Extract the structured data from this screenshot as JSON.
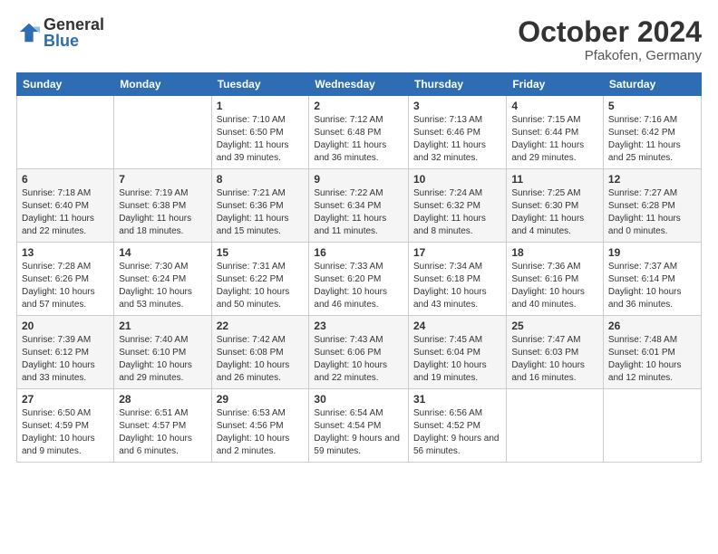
{
  "logo": {
    "general": "General",
    "blue": "Blue"
  },
  "header": {
    "month": "October 2024",
    "location": "Pfakofen, Germany"
  },
  "weekdays": [
    "Sunday",
    "Monday",
    "Tuesday",
    "Wednesday",
    "Thursday",
    "Friday",
    "Saturday"
  ],
  "weeks": [
    [
      {
        "day": "",
        "detail": ""
      },
      {
        "day": "",
        "detail": ""
      },
      {
        "day": "1",
        "detail": "Sunrise: 7:10 AM\nSunset: 6:50 PM\nDaylight: 11 hours and 39 minutes."
      },
      {
        "day": "2",
        "detail": "Sunrise: 7:12 AM\nSunset: 6:48 PM\nDaylight: 11 hours and 36 minutes."
      },
      {
        "day": "3",
        "detail": "Sunrise: 7:13 AM\nSunset: 6:46 PM\nDaylight: 11 hours and 32 minutes."
      },
      {
        "day": "4",
        "detail": "Sunrise: 7:15 AM\nSunset: 6:44 PM\nDaylight: 11 hours and 29 minutes."
      },
      {
        "day": "5",
        "detail": "Sunrise: 7:16 AM\nSunset: 6:42 PM\nDaylight: 11 hours and 25 minutes."
      }
    ],
    [
      {
        "day": "6",
        "detail": "Sunrise: 7:18 AM\nSunset: 6:40 PM\nDaylight: 11 hours and 22 minutes."
      },
      {
        "day": "7",
        "detail": "Sunrise: 7:19 AM\nSunset: 6:38 PM\nDaylight: 11 hours and 18 minutes."
      },
      {
        "day": "8",
        "detail": "Sunrise: 7:21 AM\nSunset: 6:36 PM\nDaylight: 11 hours and 15 minutes."
      },
      {
        "day": "9",
        "detail": "Sunrise: 7:22 AM\nSunset: 6:34 PM\nDaylight: 11 hours and 11 minutes."
      },
      {
        "day": "10",
        "detail": "Sunrise: 7:24 AM\nSunset: 6:32 PM\nDaylight: 11 hours and 8 minutes."
      },
      {
        "day": "11",
        "detail": "Sunrise: 7:25 AM\nSunset: 6:30 PM\nDaylight: 11 hours and 4 minutes."
      },
      {
        "day": "12",
        "detail": "Sunrise: 7:27 AM\nSunset: 6:28 PM\nDaylight: 11 hours and 0 minutes."
      }
    ],
    [
      {
        "day": "13",
        "detail": "Sunrise: 7:28 AM\nSunset: 6:26 PM\nDaylight: 10 hours and 57 minutes."
      },
      {
        "day": "14",
        "detail": "Sunrise: 7:30 AM\nSunset: 6:24 PM\nDaylight: 10 hours and 53 minutes."
      },
      {
        "day": "15",
        "detail": "Sunrise: 7:31 AM\nSunset: 6:22 PM\nDaylight: 10 hours and 50 minutes."
      },
      {
        "day": "16",
        "detail": "Sunrise: 7:33 AM\nSunset: 6:20 PM\nDaylight: 10 hours and 46 minutes."
      },
      {
        "day": "17",
        "detail": "Sunrise: 7:34 AM\nSunset: 6:18 PM\nDaylight: 10 hours and 43 minutes."
      },
      {
        "day": "18",
        "detail": "Sunrise: 7:36 AM\nSunset: 6:16 PM\nDaylight: 10 hours and 40 minutes."
      },
      {
        "day": "19",
        "detail": "Sunrise: 7:37 AM\nSunset: 6:14 PM\nDaylight: 10 hours and 36 minutes."
      }
    ],
    [
      {
        "day": "20",
        "detail": "Sunrise: 7:39 AM\nSunset: 6:12 PM\nDaylight: 10 hours and 33 minutes."
      },
      {
        "day": "21",
        "detail": "Sunrise: 7:40 AM\nSunset: 6:10 PM\nDaylight: 10 hours and 29 minutes."
      },
      {
        "day": "22",
        "detail": "Sunrise: 7:42 AM\nSunset: 6:08 PM\nDaylight: 10 hours and 26 minutes."
      },
      {
        "day": "23",
        "detail": "Sunrise: 7:43 AM\nSunset: 6:06 PM\nDaylight: 10 hours and 22 minutes."
      },
      {
        "day": "24",
        "detail": "Sunrise: 7:45 AM\nSunset: 6:04 PM\nDaylight: 10 hours and 19 minutes."
      },
      {
        "day": "25",
        "detail": "Sunrise: 7:47 AM\nSunset: 6:03 PM\nDaylight: 10 hours and 16 minutes."
      },
      {
        "day": "26",
        "detail": "Sunrise: 7:48 AM\nSunset: 6:01 PM\nDaylight: 10 hours and 12 minutes."
      }
    ],
    [
      {
        "day": "27",
        "detail": "Sunrise: 6:50 AM\nSunset: 4:59 PM\nDaylight: 10 hours and 9 minutes."
      },
      {
        "day": "28",
        "detail": "Sunrise: 6:51 AM\nSunset: 4:57 PM\nDaylight: 10 hours and 6 minutes."
      },
      {
        "day": "29",
        "detail": "Sunrise: 6:53 AM\nSunset: 4:56 PM\nDaylight: 10 hours and 2 minutes."
      },
      {
        "day": "30",
        "detail": "Sunrise: 6:54 AM\nSunset: 4:54 PM\nDaylight: 9 hours and 59 minutes."
      },
      {
        "day": "31",
        "detail": "Sunrise: 6:56 AM\nSunset: 4:52 PM\nDaylight: 9 hours and 56 minutes."
      },
      {
        "day": "",
        "detail": ""
      },
      {
        "day": "",
        "detail": ""
      }
    ]
  ]
}
